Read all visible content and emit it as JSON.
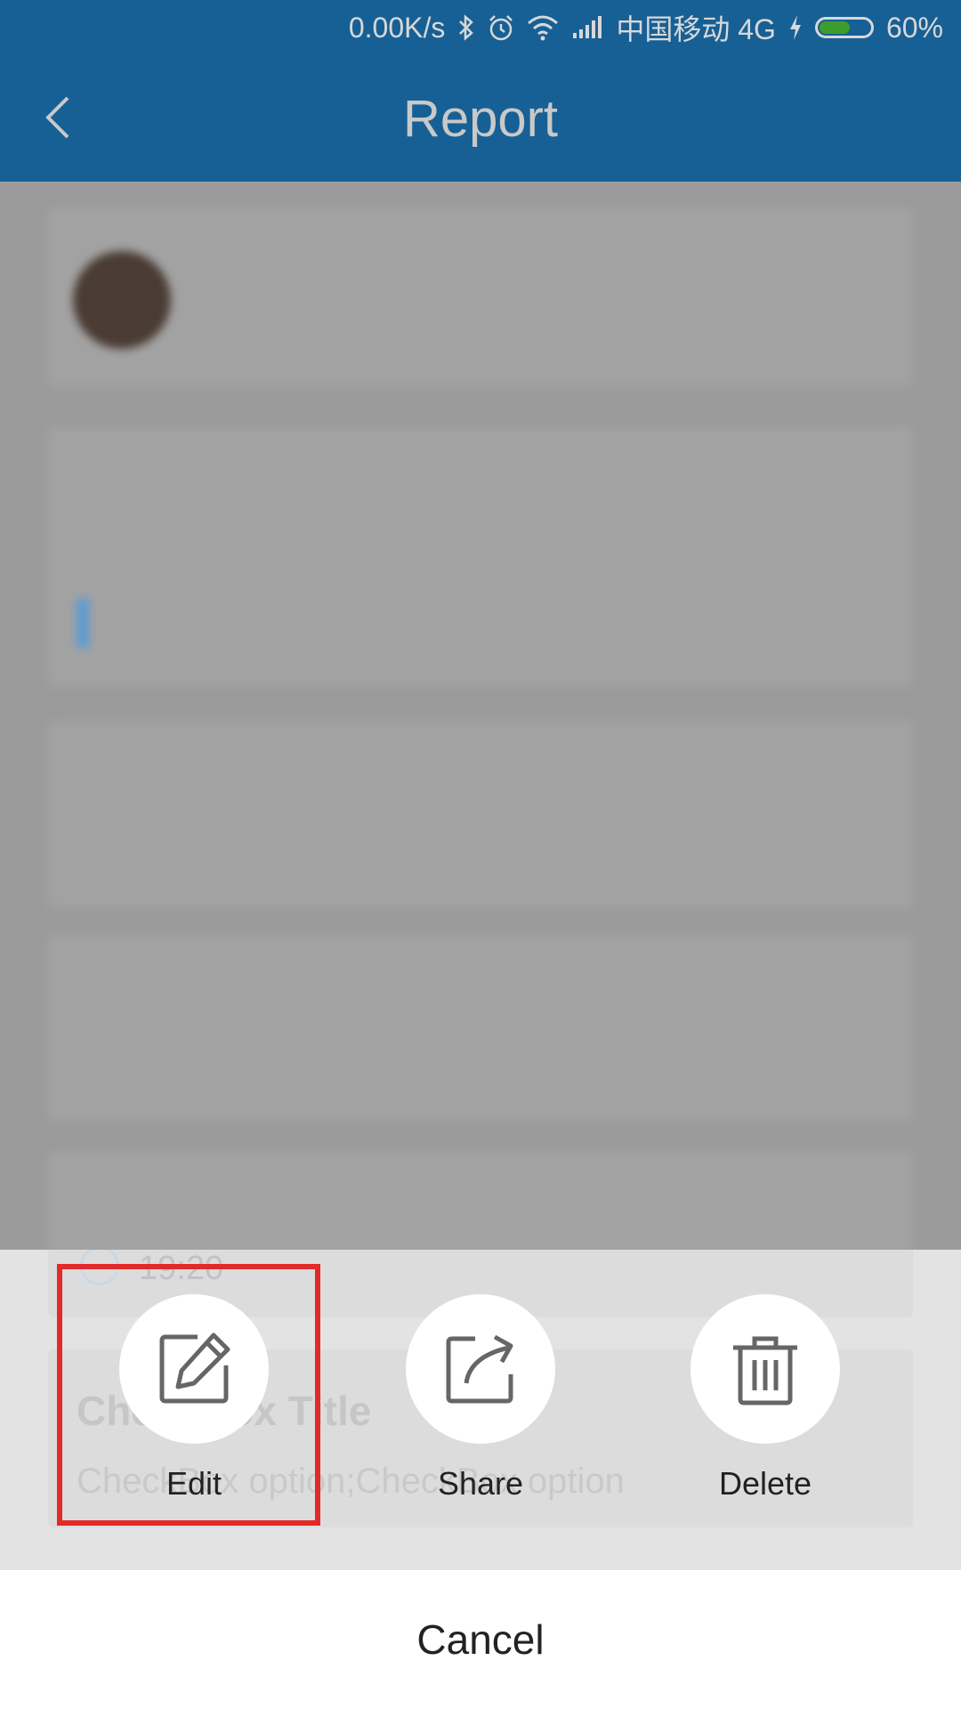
{
  "status_bar": {
    "speed": "0.00K/s",
    "carrier": "中国移动 4G",
    "battery": "60%",
    "battery_level": 0.6,
    "icons": [
      "bluetooth-icon",
      "alarm-icon",
      "wifi-icon",
      "signal-icon",
      "charging-icon",
      "battery-icon"
    ]
  },
  "app_bar": {
    "title": "Report"
  },
  "report": {
    "time_value": "19:20",
    "checkbox_title": "CheckBox Title",
    "checkbox_value": "CheckBox option;CheckBox option"
  },
  "actions": [
    {
      "label": "Edit",
      "icon": "edit-icon"
    },
    {
      "label": "Share",
      "icon": "share-icon"
    },
    {
      "label": "Delete",
      "icon": "trash-icon"
    }
  ],
  "cancel_label": "Cancel",
  "colors": {
    "primary": "#176096",
    "highlight": "#e22a2a",
    "scrim": "#9b9b9b"
  }
}
